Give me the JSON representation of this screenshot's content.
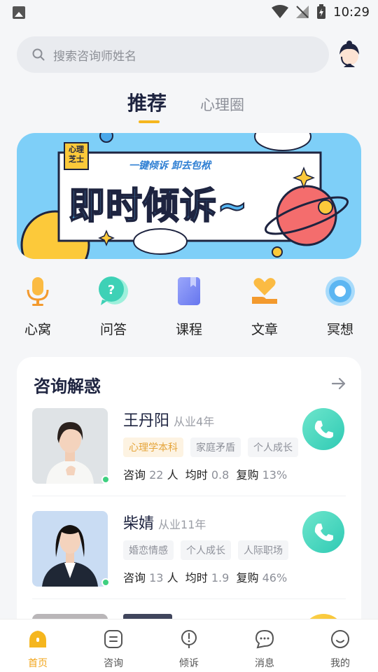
{
  "status": {
    "time": "10:29"
  },
  "search": {
    "placeholder": "搜索咨询师姓名"
  },
  "tabs": {
    "recommend": "推荐",
    "circle": "心理圈"
  },
  "banner": {
    "badge_line1": "心理",
    "badge_line2": "芝士",
    "subtitle": "一键倾诉 卸去包袱",
    "headline": "即时倾诉~"
  },
  "quick_entries": [
    {
      "label": "心窝",
      "icon": "microphone-icon"
    },
    {
      "label": "问答",
      "icon": "question-bubble-icon"
    },
    {
      "label": "课程",
      "icon": "book-icon"
    },
    {
      "label": "文章",
      "icon": "heart-hand-icon"
    },
    {
      "label": "冥想",
      "icon": "meditation-circle-icon"
    }
  ],
  "consult": {
    "title": "咨询解惑",
    "counselors": [
      {
        "name": "王丹阳",
        "years": "从业4年",
        "tags": [
          "心理学本科",
          "家庭矛盾",
          "个人成长"
        ],
        "stat_consult_label": "咨询",
        "stat_consult_value": "22",
        "stat_consult_unit": "人",
        "stat_hours_label": "均时",
        "stat_hours_value": "0.8",
        "stat_repurchase_label": "复购",
        "stat_repurchase_value": "13%"
      },
      {
        "name": "柴婧",
        "years": "从业11年",
        "tags": [
          "婚恋情感",
          "个人成长",
          "人际职场"
        ],
        "stat_consult_label": "咨询",
        "stat_consult_value": "13",
        "stat_consult_unit": "人",
        "stat_hours_label": "均时",
        "stat_hours_value": "1.9",
        "stat_repurchase_label": "复购",
        "stat_repurchase_value": "46%"
      }
    ]
  },
  "tabbar": [
    {
      "label": "首页",
      "icon": "home-icon",
      "active": true
    },
    {
      "label": "咨询",
      "icon": "consult-icon"
    },
    {
      "label": "倾诉",
      "icon": "talk-icon"
    },
    {
      "label": "消息",
      "icon": "message-icon"
    },
    {
      "label": "我的",
      "icon": "profile-icon"
    }
  ],
  "colors": {
    "accent": "#f2a51b",
    "navy": "#1e2440",
    "call": "#2fcab4",
    "banner": "#7ecff8"
  }
}
